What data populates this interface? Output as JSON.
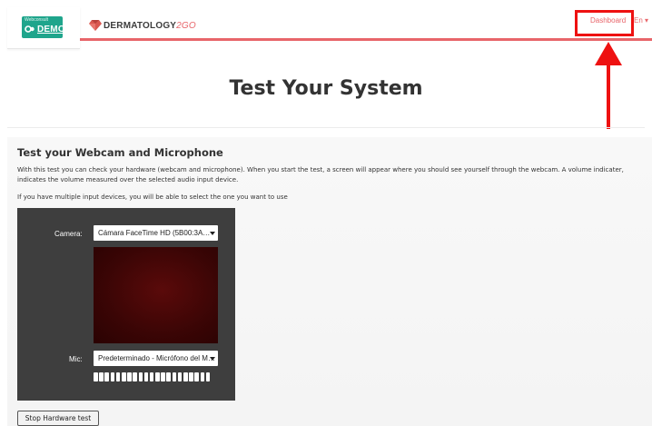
{
  "header": {
    "logo_small_text": "Webconsult",
    "logo_demo_text": "DEMO",
    "brand_name": "DERMATOLOGY",
    "brand_suffix": "2GO",
    "nav_dashboard": "Dashboard",
    "nav_language": "En ▾"
  },
  "colors": {
    "accent": "#e8656a",
    "logo_bg": "#1fa58c",
    "annotation": "#ee1111",
    "hw_bg": "#3e3e3e"
  },
  "icons": {
    "logo": "webconsult-logo-icon",
    "brand": "gem-icon",
    "annotation_arrow": "arrow-up-icon"
  },
  "page": {
    "title": "Test Your System"
  },
  "test": {
    "heading": "Test your Webcam and Microphone",
    "description": "With this test you can check your hardware (webcam and microphone). When you start the test, a screen will appear where you should see yourself through the webcam. A volume indicater, indicates the volume measured over the selected audio input device.",
    "multi_devices_note": "If you have multiple input devices, you will be able to select the one you want to use",
    "camera_label": "Camera:",
    "camera_selected": "Cámara FaceTime HD (5B00:3A…",
    "mic_label": "Mic:",
    "mic_selected": "Predeterminado - Micrófono del M…",
    "stop_button": "Stop Hardware test"
  }
}
